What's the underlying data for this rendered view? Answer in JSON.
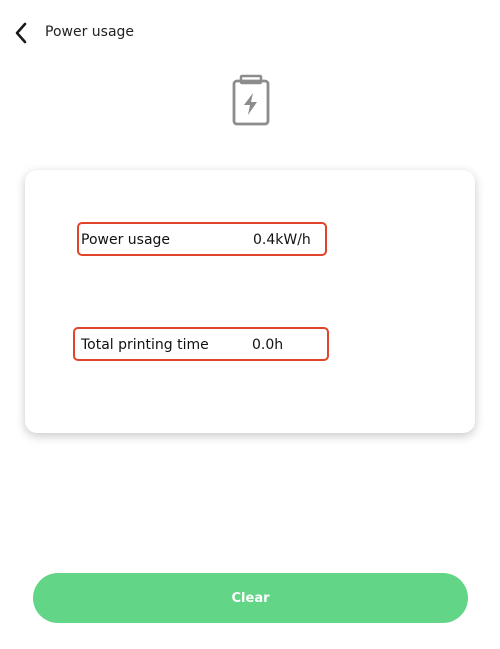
{
  "header": {
    "back_icon": "chevron-left-icon",
    "title": "Power usage"
  },
  "hero": {
    "icon": "battery-charging-icon",
    "icon_color": "#8c8c8c"
  },
  "stats": {
    "power": {
      "label": "Power usage",
      "value": "0.4kW/h"
    },
    "time": {
      "label": "Total printing time",
      "value": "0.0h"
    },
    "highlight_color": "#e2432b"
  },
  "actions": {
    "clear_label": "Clear",
    "clear_color": "#63d586"
  }
}
